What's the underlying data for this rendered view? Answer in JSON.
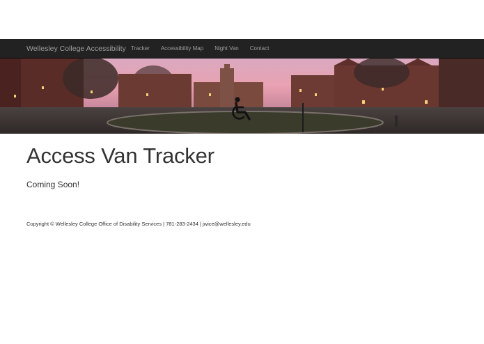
{
  "navbar": {
    "brand": "Wellesley College Accessibility",
    "links": [
      "Tracker",
      "Accessibility Map",
      "Night Van",
      "Contact"
    ]
  },
  "banner": {
    "icon": "wheelchair-icon"
  },
  "main": {
    "title": "Access Van Tracker",
    "lead": "Coming Soon!"
  },
  "footer": {
    "text": "Copyright © Wellesley College Office of Disability Services | 781-283-2434 | jwice@wellesley.edu"
  },
  "colors": {
    "navbar_bg": "#222222",
    "navbar_text": "#9d9d9d",
    "body_text": "#333333",
    "sky_pink": "#e8a5b8"
  }
}
